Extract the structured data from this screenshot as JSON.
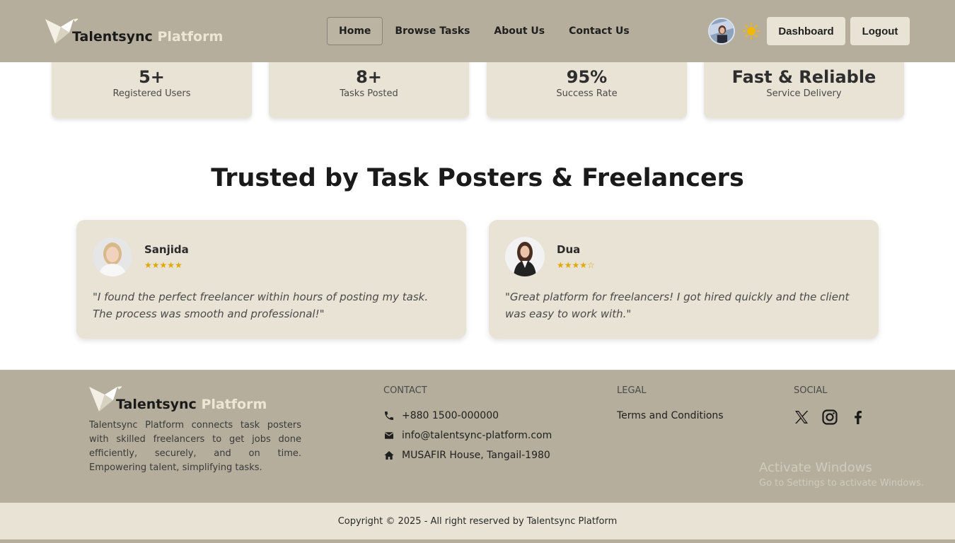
{
  "brand": {
    "name_part1": "Talentsync",
    "name_part2": "Platform"
  },
  "nav": {
    "links": [
      "Home",
      "Browse Tasks",
      "About Us",
      "Contact Us"
    ],
    "active": "Home",
    "dashboard_label": "Dashboard",
    "logout_label": "Logout",
    "theme_icon": "sun-icon"
  },
  "stats": [
    {
      "value": "5+",
      "label": "Registered Users"
    },
    {
      "value": "8+",
      "label": "Tasks Posted"
    },
    {
      "value": "95%",
      "label": "Success Rate"
    },
    {
      "value": "Fast & Reliable",
      "label": "Service Delivery"
    }
  ],
  "testimonials": {
    "title": "Trusted by Task Posters & Freelancers",
    "items": [
      {
        "name": "Sanjida",
        "rating": 5,
        "stars": "★★★★★",
        "quote": "\"I found the perfect freelancer within hours of posting my task. The process was smooth and professional!\""
      },
      {
        "name": "Dua",
        "rating": 4,
        "stars": "★★★★☆",
        "quote": "\"Great platform for freelancers! I got hired quickly and the client was easy to work with.\""
      }
    ]
  },
  "footer": {
    "description": "Talentsync Platform connects task posters with skilled freelancers to get jobs done efficiently, securely, and on time. Empowering talent, simplifying tasks.",
    "contact": {
      "heading": "CONTACT",
      "phone": "+880 1500-000000",
      "email": "info@talentsync-platform.com",
      "address": "MUSAFIR House, Tangail-1980"
    },
    "legal": {
      "heading": "LEGAL",
      "terms": "Terms and Conditions"
    },
    "social": {
      "heading": "SOCIAL",
      "icons": [
        "x-icon",
        "instagram-icon",
        "facebook-icon"
      ]
    },
    "watermark_title": "Activate Windows",
    "watermark_sub": "Go to Settings to activate Windows.",
    "copyright": "Copyright © 2025 - All right reserved by Talentsync Platform"
  },
  "colors": {
    "nav_bg": "#b5ae9c",
    "card_bg": "#e8e3d4",
    "star": "#e0a800"
  }
}
